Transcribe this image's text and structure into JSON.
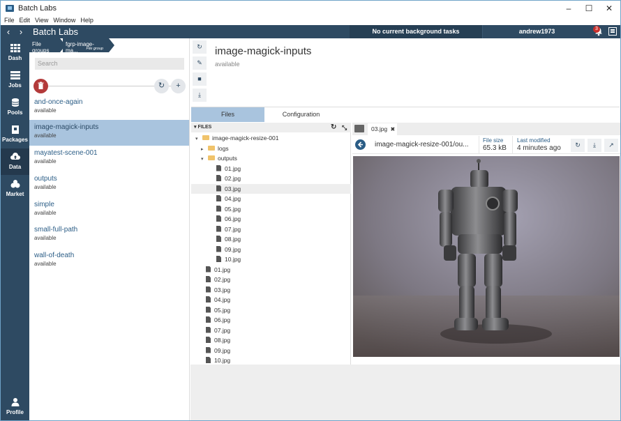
{
  "window": {
    "title": "Batch Labs",
    "minimize": "–",
    "maximize": "☐",
    "close": "✕"
  },
  "menu": [
    "File",
    "Edit",
    "View",
    "Window",
    "Help"
  ],
  "header": {
    "back": "‹",
    "forward": "›",
    "app_name": "Batch Labs",
    "background_tasks": "No current background tasks",
    "user": "andrew1973",
    "notification_count": "3"
  },
  "nav": [
    {
      "label": "Dash",
      "icon": "grid-icon"
    },
    {
      "label": "Jobs",
      "icon": "jobs-icon"
    },
    {
      "label": "Pools",
      "icon": "database-icon"
    },
    {
      "label": "Packages",
      "icon": "package-icon"
    },
    {
      "label": "Data",
      "icon": "cloud-upload-icon"
    },
    {
      "label": "Market",
      "icon": "market-icon"
    },
    {
      "label": "Profile",
      "icon": "user-icon"
    }
  ],
  "breadcrumb": {
    "first": "File groups",
    "second": "fgrp-image-ma...",
    "second_sub": "File group"
  },
  "search": {
    "placeholder": "Search"
  },
  "file_groups": [
    {
      "name": "and-once-again",
      "status": "available"
    },
    {
      "name": "image-magick-inputs",
      "status": "available"
    },
    {
      "name": "mayatest-scene-001",
      "status": "available"
    },
    {
      "name": "outputs",
      "status": "available"
    },
    {
      "name": "simple",
      "status": "available"
    },
    {
      "name": "small-full-path",
      "status": "available"
    },
    {
      "name": "wall-of-death",
      "status": "available"
    }
  ],
  "detail": {
    "title": "image-magick-inputs",
    "state": "available"
  },
  "tabs": [
    "Files",
    "Configuration"
  ],
  "tree": {
    "header": "FILES",
    "root": "image-magick-resize-001",
    "logs": "logs",
    "outputs": "outputs",
    "output_files": [
      "01.jpg",
      "02.jpg",
      "03.jpg",
      "04.jpg",
      "05.jpg",
      "06.jpg",
      "07.jpg",
      "08.jpg",
      "09.jpg",
      "10.jpg"
    ],
    "root_files": [
      "01.jpg",
      "02.jpg",
      "03.jpg",
      "04.jpg",
      "05.jpg",
      "06.jpg",
      "07.jpg",
      "08.jpg",
      "09.jpg",
      "10.jpg"
    ]
  },
  "preview": {
    "tab": "03.jpg",
    "path": "image-magick-resize-001/ou...",
    "file_size_label": "File size",
    "file_size": "65.3 kB",
    "modified_label": "Last modified",
    "modified": "4 minutes ago"
  },
  "colors": {
    "header": "#2e4a62",
    "selected": "#a9c4de",
    "delete": "#b33a3a",
    "link": "#2b5d86"
  }
}
